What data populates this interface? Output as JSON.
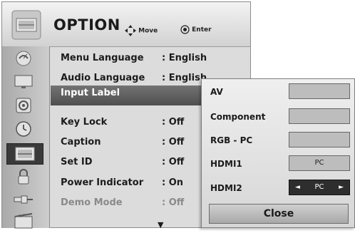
{
  "header": {
    "title": "OPTION",
    "icon": "option-menu-icon",
    "hints": [
      {
        "icon": "dpad-arrows-icon",
        "label": "Move"
      },
      {
        "icon": "ok-circle-icon",
        "label": "Enter"
      }
    ]
  },
  "sidebar": {
    "items": [
      {
        "icon": "satellite-dish-icon",
        "selected": false
      },
      {
        "icon": "monitor-icon",
        "selected": false
      },
      {
        "icon": "speaker-icon",
        "selected": false
      },
      {
        "icon": "clock-icon",
        "selected": false
      },
      {
        "icon": "option-menu-icon",
        "selected": true
      },
      {
        "icon": "lock-icon",
        "selected": false
      },
      {
        "icon": "input-plug-icon",
        "selected": false
      },
      {
        "icon": "media-film-icon",
        "selected": false
      }
    ]
  },
  "menu": {
    "items": [
      {
        "label": "Menu Language",
        "value": ": English"
      },
      {
        "label": "Audio Language",
        "value": ": English"
      },
      {
        "label": "Input Label",
        "value": ""
      },
      {
        "label": "Key Lock",
        "value": ": Off"
      },
      {
        "label": "Caption",
        "value": ": Off"
      },
      {
        "label": "Set ID",
        "value": ": Off"
      },
      {
        "label": "Power Indicator",
        "value": ": On"
      },
      {
        "label": "Demo Mode",
        "value": ": Off"
      }
    ],
    "more_indicator": "▼"
  },
  "popup": {
    "rows": [
      {
        "label": "AV",
        "value": ""
      },
      {
        "label": "Component",
        "value": ""
      },
      {
        "label": "RGB - PC",
        "value": ""
      },
      {
        "label": "HDMI1",
        "value": "PC"
      },
      {
        "label": "HDMI2",
        "value": "PC",
        "left_arrow": "◄",
        "right_arrow": "►"
      }
    ],
    "close_label": "Close"
  },
  "colors": {
    "highlight": "#5f5f5f",
    "selected_field": "#2e2e2e",
    "panel": "#dcdcdc"
  }
}
